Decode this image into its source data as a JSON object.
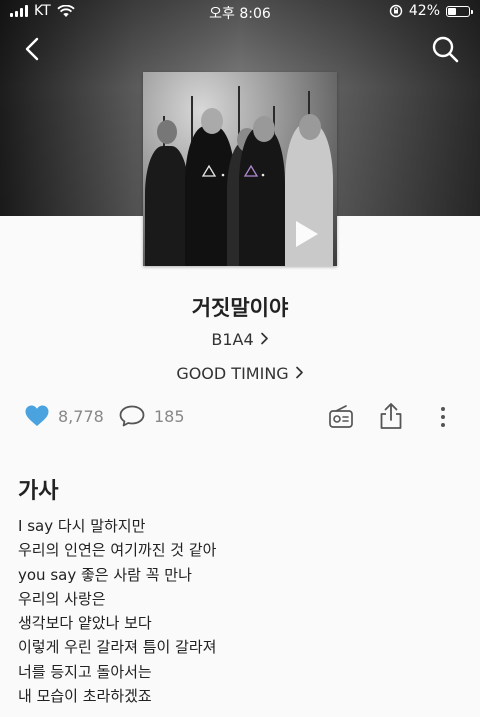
{
  "status_bar": {
    "carrier": "KT",
    "time": "오후 8:06",
    "battery_percent": "42%",
    "battery_level": 0.42
  },
  "nav": {
    "back_icon": "chevron-left-icon",
    "search_icon": "search-icon"
  },
  "song": {
    "title": "거짓말이야",
    "artist": "B1A4",
    "album": "GOOD TIMING",
    "chevron": "›"
  },
  "actions": {
    "likes": "8,778",
    "comments": "185",
    "like_color": "#4aa3df",
    "icons": [
      "heart-icon",
      "comment-icon",
      "radio-icon",
      "share-icon",
      "more-icon"
    ]
  },
  "lyrics": {
    "heading": "가사",
    "lines": [
      "I say 다시 말하지만",
      "우리의 인연은 여기까진 것 같아",
      "you say 좋은 사람 꼭 만나",
      "우리의 사랑은",
      "생각보다 얕았나 보다",
      "이렇게 우린 갈라져 틈이 갈라져",
      "너를 등지고 돌아서는",
      "내 모습이 초라하겠죠"
    ]
  }
}
